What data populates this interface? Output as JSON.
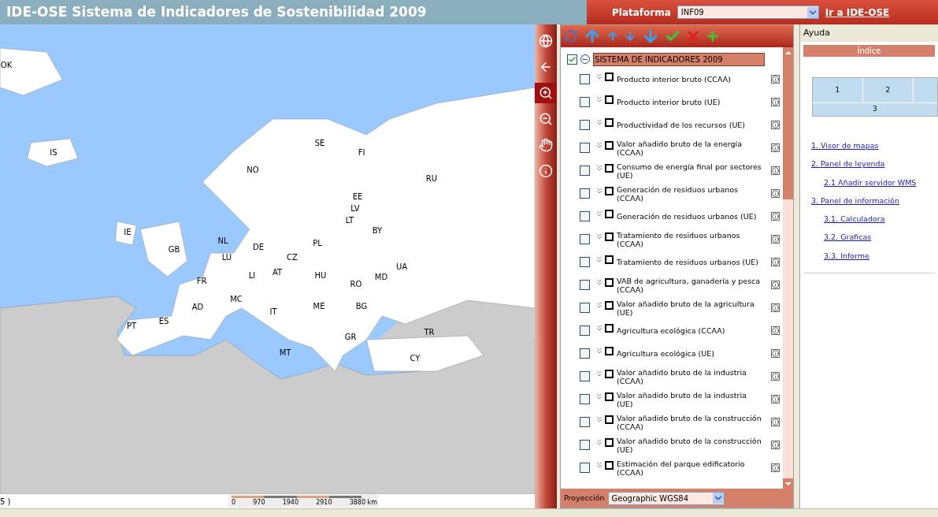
{
  "header": {
    "title": "IDE-OSE Sistema de Indicadores de Sostenibilidad 2009",
    "platform_label": "Plataforma",
    "platform_value": "INF09",
    "link": "Ir a IDE-OSE"
  },
  "map": {
    "labels": [
      "OK",
      "SE",
      "IS",
      "FI",
      "NO",
      "RU",
      "EE",
      "LV",
      "LT",
      "BY",
      "IE",
      "NL",
      "PL",
      "DE",
      "GB",
      "LU",
      "CZ",
      "UA",
      "AT",
      "LI",
      "HU",
      "MD",
      "FR",
      "RO",
      "MC",
      "AD",
      "ME",
      "BG",
      "IT",
      "ES",
      "PT",
      "TR",
      "GR",
      "MT",
      "CY"
    ],
    "coordinates": "5 )",
    "scale": [
      "0",
      "970",
      "1940",
      "2910",
      "3880 km"
    ]
  },
  "map_tools": [
    {
      "kind": "globe",
      "selected": false
    },
    {
      "kind": "back",
      "selected": false
    },
    {
      "kind": "zoomin",
      "selected": true
    },
    {
      "kind": "zoomout",
      "selected": false
    },
    {
      "kind": "pan",
      "selected": false
    },
    {
      "kind": "info",
      "selected": false
    }
  ],
  "legend": {
    "root": {
      "label": "SISTEMA DE INDICADORES 2009",
      "checked": true,
      "expanded": true,
      "selected": true
    },
    "layers": [
      {
        "label": "Producto interior bruto (CCAA)",
        "checked": false
      },
      {
        "label": "Producto interior bruto (UE)",
        "checked": false
      },
      {
        "label": "Productividad de los recursos (UE)",
        "checked": false
      },
      {
        "label": "Valor añadido bruto de la energía (CCAA)",
        "checked": false
      },
      {
        "label": "Consumo de energía final por sectores (UE)",
        "checked": false
      },
      {
        "label": "Generación de residuos urbanos (CCAA)",
        "checked": false
      },
      {
        "label": "Generación de residuos urbanos (UE)",
        "checked": false
      },
      {
        "label": "Tratamiento de residuos urbanos (CCAA)",
        "checked": false
      },
      {
        "label": "Tratamiento de residuos urbanos (UE)",
        "checked": false
      },
      {
        "label": "VAB de agricultura, ganadería y pesca (CCAA)",
        "checked": false
      },
      {
        "label": "Valor añadido bruto de la agricultura (UE)",
        "checked": false
      },
      {
        "label": "Agricultura ecológica (CCAA)",
        "checked": false
      },
      {
        "label": "Agricultura ecológica (UE)",
        "checked": false
      },
      {
        "label": "Valor añadido bruto de la industria (CCAA)",
        "checked": false
      },
      {
        "label": "Valor añadido bruto de la industria (UE)",
        "checked": false
      },
      {
        "label": "Valor añadido bruto de la construcción (CCAA)",
        "checked": false
      },
      {
        "label": "Valor añadido bruto de la construcción (UE)",
        "checked": false
      },
      {
        "label": "Estimación del parque edificatorio (CCAA)",
        "checked": false
      }
    ],
    "projection_label": "Proyección",
    "projection_value": "Geographic WGS84"
  },
  "help": {
    "title": "Ayuda",
    "index_title": "Índice",
    "grid": [
      "1",
      "2",
      "3"
    ],
    "links": [
      {
        "label": "1. Visor de mapas"
      },
      {
        "label": "2. Panel de leyenda",
        "children": [
          {
            "label": "2.1 Añadir servidor WMS"
          }
        ]
      },
      {
        "label": "3. Panel de información",
        "children": [
          {
            "label": "3.1. Calculadora"
          },
          {
            "label": "3.2. Graficas"
          },
          {
            "label": "3.3. Informe"
          }
        ]
      }
    ]
  }
}
